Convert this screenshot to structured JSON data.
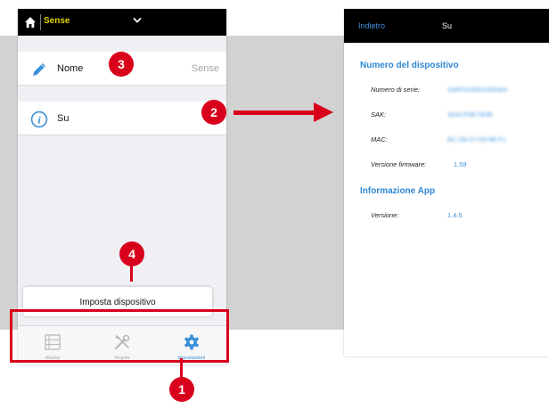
{
  "left_phone": {
    "device_selector": {
      "value": "Sense"
    },
    "rows": [
      {
        "label": "Nome",
        "value": "Sense",
        "icon": "pencil-icon"
      },
      {
        "label": "Su",
        "icon": "info-icon"
      }
    ],
    "setup_button": {
      "label": "Imposta dispositivo"
    },
    "tabbar": [
      {
        "label": "display",
        "icon": "list-icon",
        "active": false
      },
      {
        "label": "Regole",
        "icon": "tools-icon",
        "active": false
      },
      {
        "label": "impostazioni",
        "icon": "gear-icon",
        "active": true
      }
    ]
  },
  "right_phone": {
    "back_label": "Indietro",
    "title": "Su",
    "device_section": {
      "heading": "Numero del dispositivo",
      "fields": [
        {
          "label": "Numero di serie:",
          "value": "SWP023001000304"
        },
        {
          "label": "SAK:",
          "value": "30ACF8E7B3B"
        },
        {
          "label": "MAC:",
          "value": "BC:2B:D7:00:8B:F1"
        },
        {
          "label": "Versione firmware:",
          "value": "1.59"
        }
      ]
    },
    "app_section": {
      "heading": "Informazione App",
      "fields": [
        {
          "label": "Versione:",
          "value": "1.4.5"
        }
      ]
    }
  },
  "annotations": {
    "badges": [
      "1",
      "2",
      "3",
      "4"
    ]
  },
  "colors": {
    "accent_blue": "#3b8fd8",
    "annotation_red": "#d9001b",
    "device_name_yellow": "#e3d200",
    "background_grey": "#d2d2d2"
  }
}
